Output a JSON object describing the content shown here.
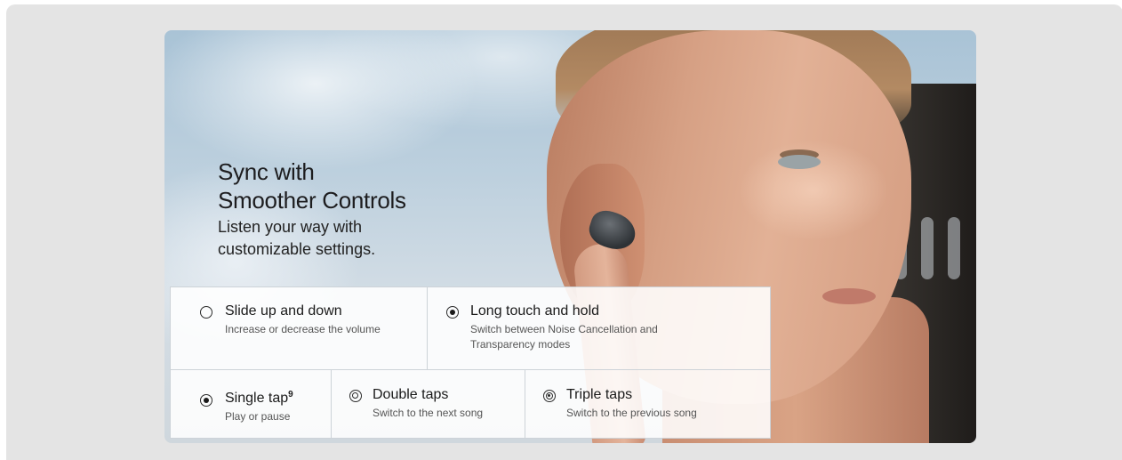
{
  "hero": {
    "heading_line1": "Sync with",
    "heading_line2": "Smoother Controls",
    "subheading_line1": "Listen your way with",
    "subheading_line2": "customizable settings."
  },
  "controls": [
    {
      "title": "Slide up and down",
      "superscript": "",
      "description": "Increase or decrease the volume",
      "icon": "radio-empty-icon"
    },
    {
      "title": "Long touch and hold",
      "superscript": "",
      "description": "Switch between Noise Cancellation and Transparency modes",
      "icon": "radio-filled-icon"
    },
    {
      "title": "Single tap",
      "superscript": "9",
      "description": "Play or pause",
      "icon": "radio-filled-icon"
    },
    {
      "title": "Double taps",
      "superscript": "",
      "description": "Switch to the next song",
      "icon": "radio-double-ring-icon"
    },
    {
      "title": "Triple taps",
      "superscript": "",
      "description": "Switch to the previous song",
      "icon": "radio-triple-ring-icon"
    }
  ],
  "colors": {
    "frame_background": "#e4e4e4",
    "text_primary": "#1d1d1f",
    "text_secondary": "#555555",
    "panel_background": "#ffffff"
  }
}
